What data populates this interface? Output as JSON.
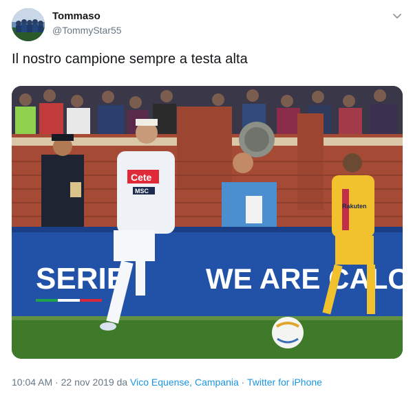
{
  "author": {
    "name": "Tommaso",
    "handle": "@TommyStar55",
    "avatar_icon": "avatar-photo-team"
  },
  "tweet": {
    "text": "Il nostro campione sempre a testa alta",
    "menu_icon": "chevron-down-icon"
  },
  "media": {
    "banner_left": "SERIE",
    "banner_right": "WE ARE CALCIO",
    "sponsor": "Cete",
    "sponsor2": "MSC",
    "opponent_sponsor": "Rakuten"
  },
  "meta": {
    "time": "10:04 AM",
    "sep1": "·",
    "date": "22 nov 2019",
    "da": "da",
    "location": "Vico Equense, Campania",
    "sep2": "·",
    "source": "Twitter for iPhone"
  },
  "colors": {
    "link": "#1b95e0",
    "secondary": "#657786",
    "text": "#14171a"
  }
}
